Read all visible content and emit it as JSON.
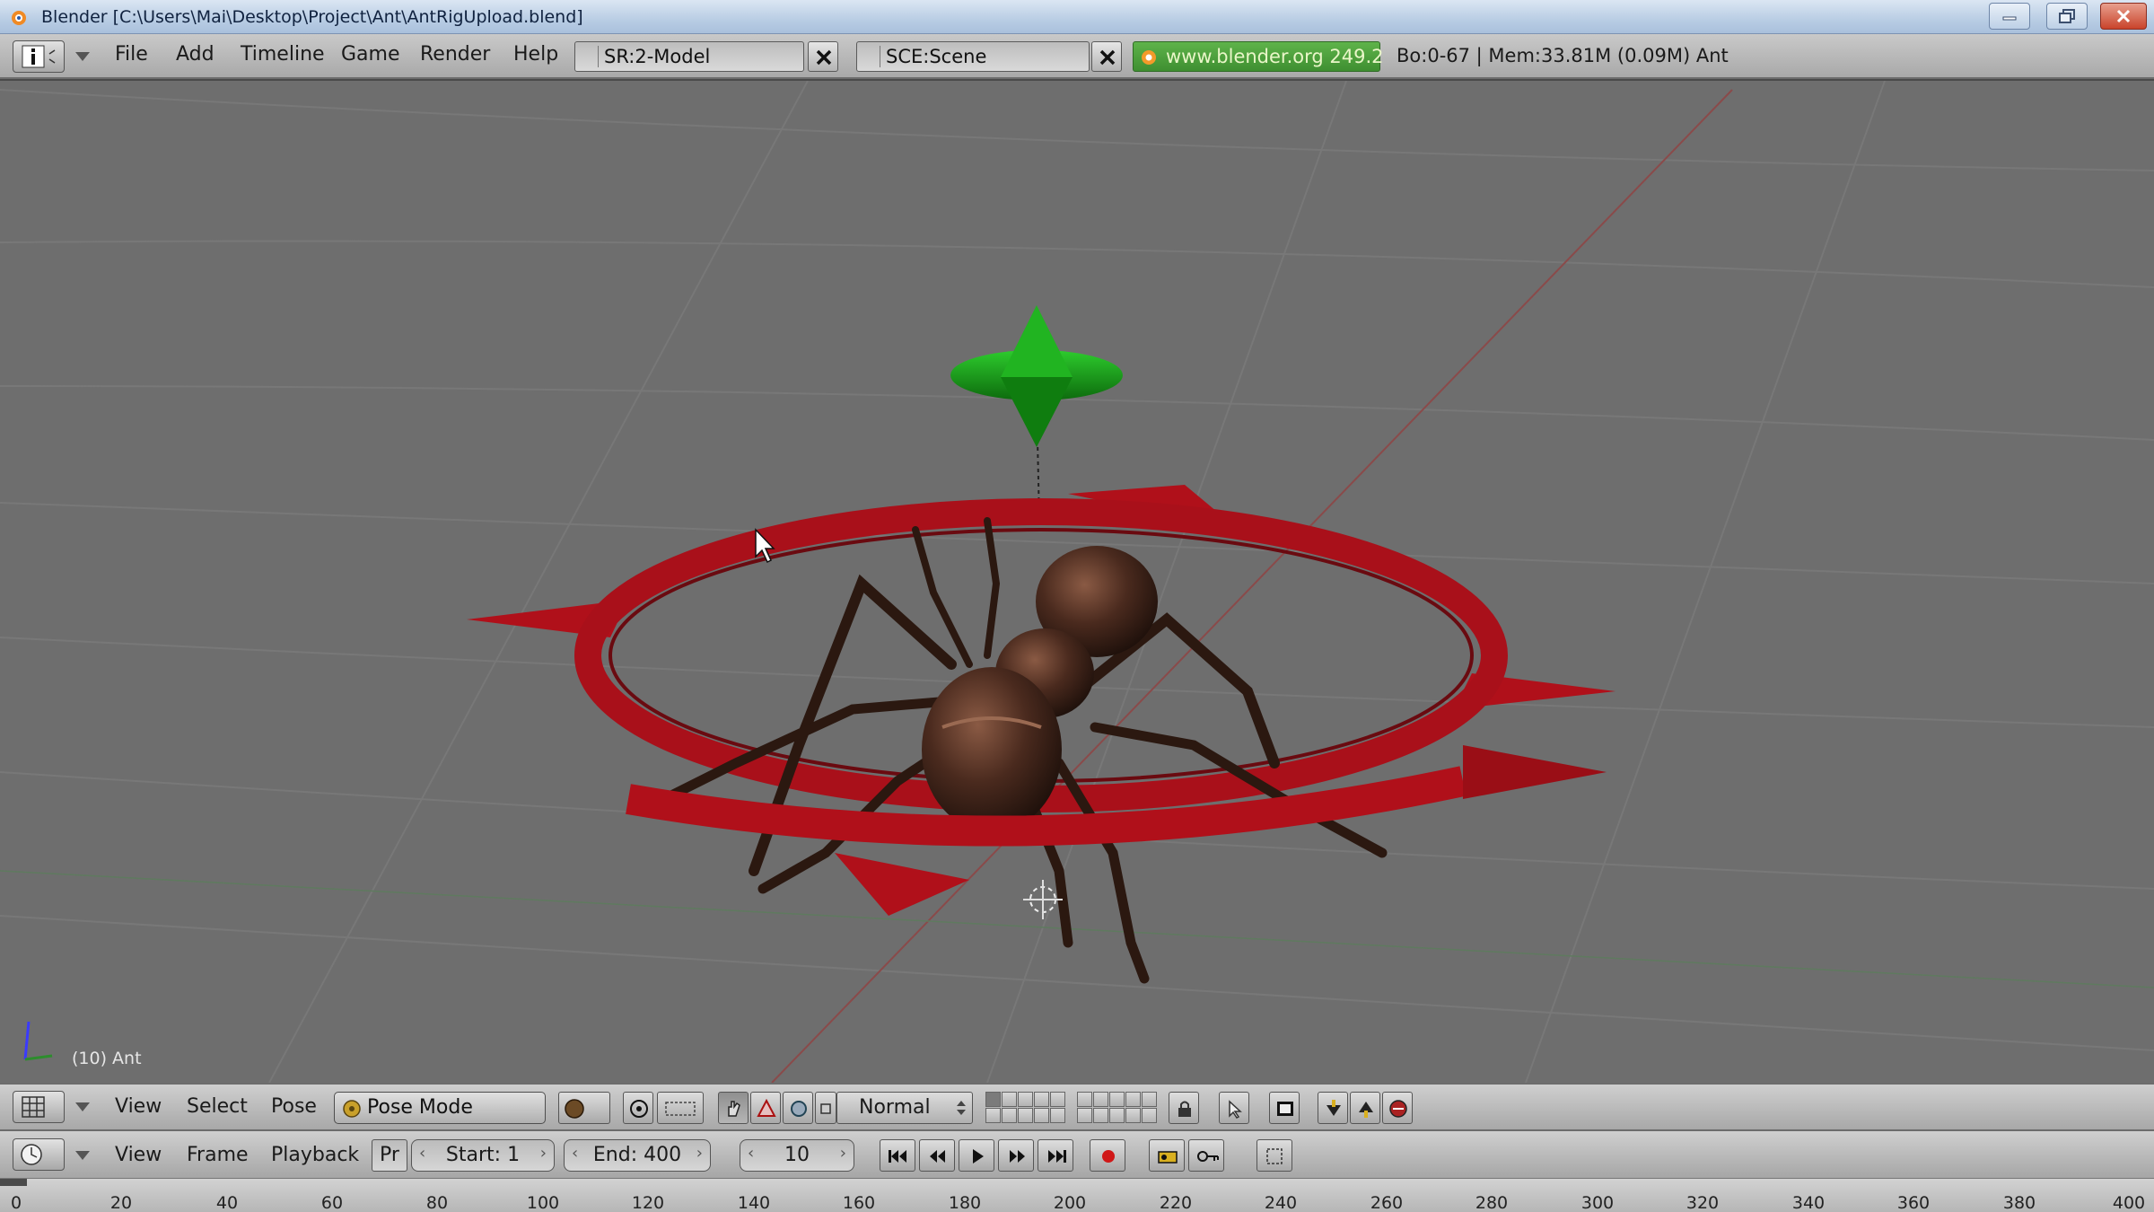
{
  "window": {
    "title": "Blender [C:\\Users\\Mai\\Desktop\\Project\\Ant\\AntRigUpload.blend]"
  },
  "info_header": {
    "menus": [
      "File",
      "Add",
      "Timeline",
      "Game",
      "Render",
      "Help"
    ],
    "screen": "SR:2-Model",
    "scene": "SCE:Scene",
    "website": "www.blender.org 249.2",
    "stats": "Bo:0-67  | Mem:33.81M (0.09M) Ant"
  },
  "viewport": {
    "object_label": "(10) Ant"
  },
  "view3d_header": {
    "menus": [
      "View",
      "Select",
      "Pose"
    ],
    "mode": "Pose Mode",
    "orientation": "Normal"
  },
  "timeline_header": {
    "menus": [
      "View",
      "Frame",
      "Playback"
    ],
    "preview_label": "Pr",
    "start": "Start: 1",
    "end": "End: 400",
    "current_frame": "10"
  },
  "ruler": {
    "ticks": [
      "0",
      "20",
      "40",
      "60",
      "80",
      "100",
      "120",
      "140",
      "160",
      "180",
      "200",
      "220",
      "240",
      "260",
      "280",
      "300",
      "320",
      "340",
      "360",
      "380",
      "400"
    ]
  },
  "colors": {
    "viewport_bg": "#6e6e6e",
    "ring_red": "#b0101a",
    "control_green": "#1fa61f",
    "ant_brown": "#3c2218",
    "website_green": "#4ea23c"
  }
}
